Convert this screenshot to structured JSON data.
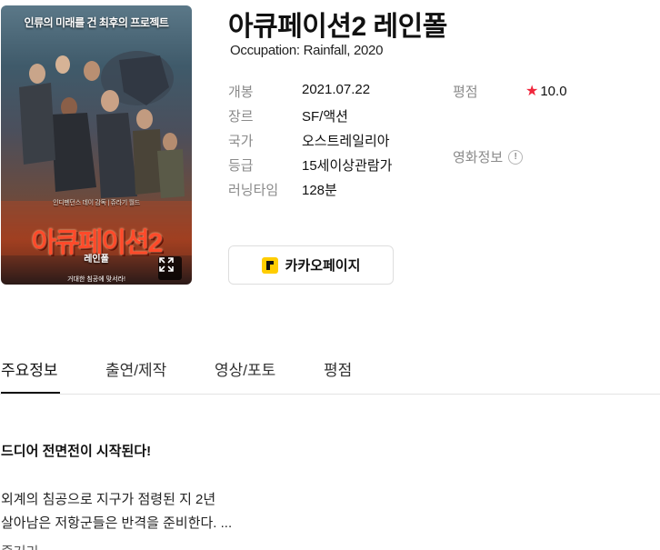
{
  "poster": {
    "tagline": "인류의 미래를 건 최후의 프로젝트",
    "credit_text": "인디펜던스 데이 감독 | 쥬라기 월드",
    "logo_text": "아큐페이션2",
    "logo_sub": "레인폴",
    "bottom_text": "거대한 침공에 맞서라!",
    "expand_icon": "expand-icon"
  },
  "movie": {
    "title": "아큐페이션2 레인폴",
    "original_title": "Occupation: Rainfall, 2020"
  },
  "info": [
    {
      "label": "개봉",
      "value": "2021.07.22"
    },
    {
      "label": "장르",
      "value": "SF/액션"
    },
    {
      "label": "국가",
      "value": "오스트레일리아"
    },
    {
      "label": "등급",
      "value": "15세이상관람가"
    },
    {
      "label": "러닝타임",
      "value": "128분"
    }
  ],
  "rating": {
    "label": "평점",
    "value": "10.0",
    "star_color": "#f0263c"
  },
  "movie_info_link": {
    "label": "영화정보",
    "icon": "info-icon"
  },
  "kakao_button": {
    "label": "카카오페이지",
    "brand_color": "#ffcd00"
  },
  "tabs": [
    {
      "label": "주요정보",
      "active": true
    },
    {
      "label": "출연/제작",
      "active": false
    },
    {
      "label": "영상/포토",
      "active": false
    },
    {
      "label": "평점",
      "active": false
    }
  ],
  "synopsis": {
    "headline": "드디어 전면전이 시작된다!",
    "lines": [
      "외계의 침공으로 지구가 점령된 지 2년",
      "살아남은 저항군들은 반격을 준비한다. ..."
    ],
    "cut_off_text": "줄거리"
  }
}
